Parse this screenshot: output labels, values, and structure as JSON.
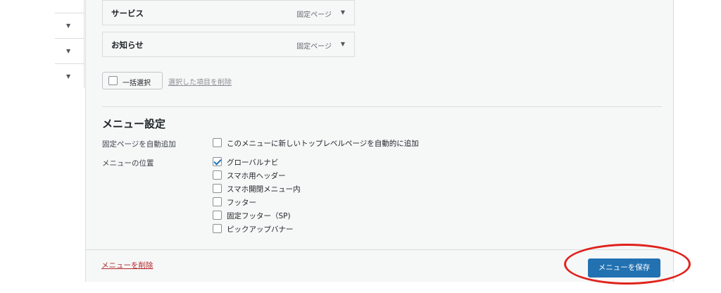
{
  "sidebar": {
    "rows": [
      {
        "arrow": "▼"
      },
      {
        "arrow": "▼"
      },
      {
        "arrow": "▼"
      }
    ]
  },
  "menu_items": [
    {
      "title": "サービス",
      "type": "固定ページ",
      "toggle": "▼"
    },
    {
      "title": "お知らせ",
      "type": "固定ページ",
      "toggle": "▼"
    }
  ],
  "bulk": {
    "select_label": "一括選択",
    "delete_selected": "選択した項目を削除"
  },
  "settings": {
    "title": "メニュー設定",
    "auto_add_label": "固定ページを自動追加",
    "auto_add_option": "このメニューに新しいトップレベルページを自動的に追加",
    "location_label": "メニューの位置",
    "locations": [
      {
        "label": "グローバルナビ",
        "checked": true
      },
      {
        "label": "スマホ用ヘッダー",
        "checked": false
      },
      {
        "label": "スマホ開閉メニュー内",
        "checked": false
      },
      {
        "label": "フッター",
        "checked": false
      },
      {
        "label": "固定フッター（SP)",
        "checked": false
      },
      {
        "label": "ピックアップバナー",
        "checked": false
      }
    ]
  },
  "footer": {
    "delete_menu": "メニューを削除",
    "save_label": "メニューを保存"
  },
  "colors": {
    "accent": "#2271b1",
    "danger": "#b32d2e",
    "highlight": "#e0221c"
  }
}
